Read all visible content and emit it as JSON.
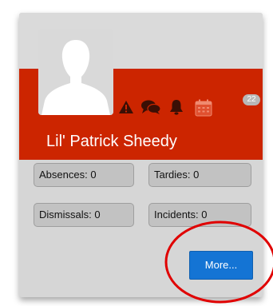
{
  "student": {
    "name": "Lil' Patrick Sheedy"
  },
  "header_icons": {
    "alert_icon": "warning-triangle",
    "messages_icon": "chat-bubbles",
    "notifications_icon": "bell",
    "calendar_icon": "calendar",
    "calendar_badge": "22"
  },
  "stats": {
    "absences": "Absences: 0",
    "tardies": "Tardies: 0",
    "dismissals": "Dismissals: 0",
    "incidents": "Incidents: 0"
  },
  "actions": {
    "more_label": "More..."
  },
  "colors": {
    "header_red": "#cc2500",
    "card_gray": "#d6d6d6",
    "button_blue": "#1474d4",
    "annotation_red": "#e00000"
  }
}
